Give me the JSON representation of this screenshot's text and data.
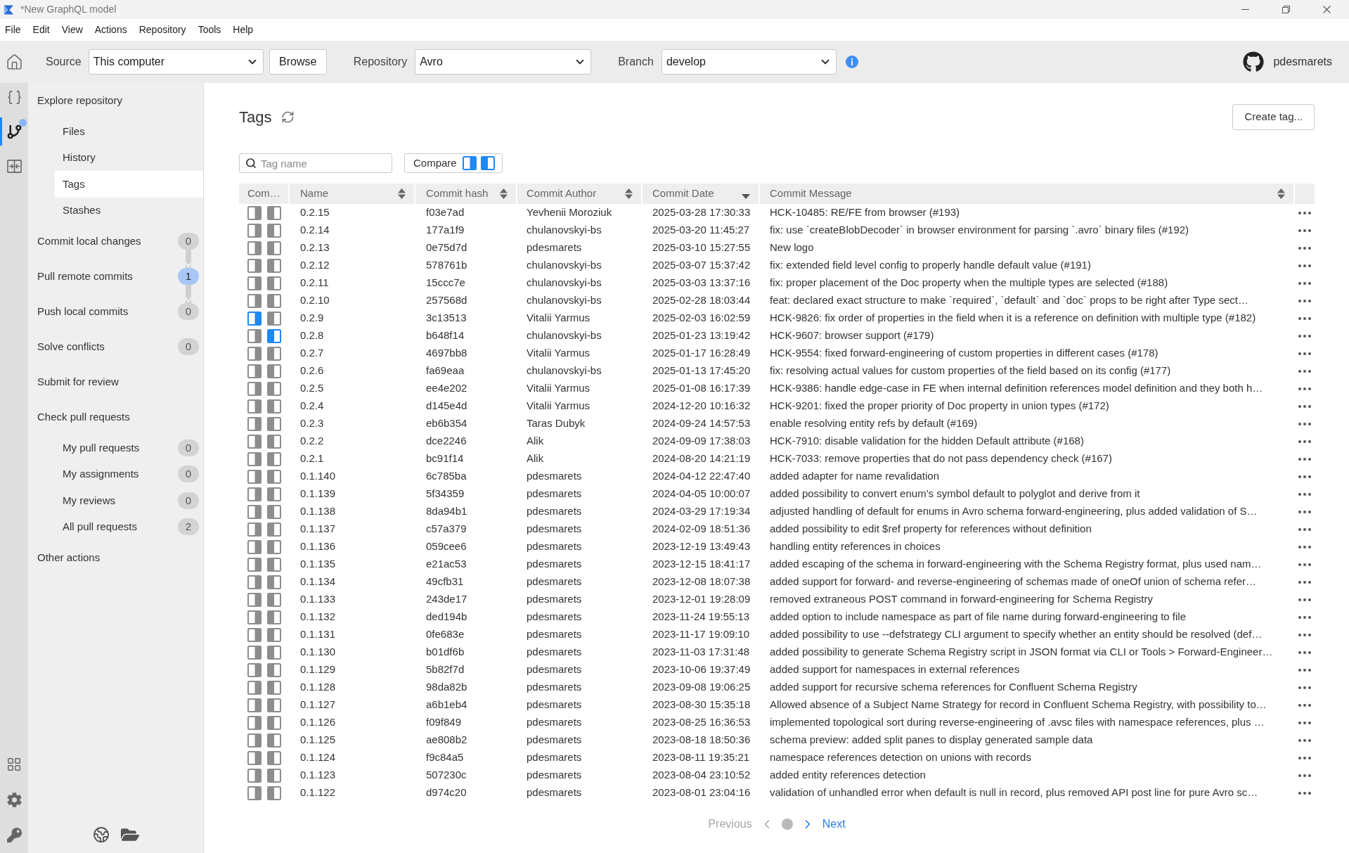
{
  "window": {
    "title": "*New GraphQL model"
  },
  "menu": [
    "File",
    "Edit",
    "View",
    "Actions",
    "Repository",
    "Tools",
    "Help"
  ],
  "toolbar": {
    "source": {
      "label": "Source",
      "value": "This computer"
    },
    "browse_button": "Browse",
    "repository": {
      "label": "Repository",
      "value": "Avro"
    },
    "branch": {
      "label": "Branch",
      "value": "develop"
    },
    "user": "pdesmarets"
  },
  "rail": {
    "items": [
      {
        "selected": false,
        "notification": false
      },
      {
        "selected": true,
        "notification": true
      },
      {
        "selected": false,
        "notification": false
      }
    ]
  },
  "sidebar": {
    "items": [
      {
        "label": "Explore repository",
        "selected": false,
        "children": [
          {
            "label": "Files",
            "selected": false
          },
          {
            "label": "History",
            "selected": false
          },
          {
            "label": "Tags",
            "selected": true
          },
          {
            "label": "Stashes",
            "selected": false
          }
        ]
      },
      {
        "label": "Commit local changes",
        "selected": false,
        "count": "0",
        "highlighted": false,
        "chained": true
      },
      {
        "label": "Pull remote commits",
        "selected": false,
        "count": "1",
        "highlighted": true,
        "chained": true
      },
      {
        "label": "Push local commits",
        "selected": false,
        "count": "0",
        "highlighted": false,
        "chained": true
      },
      {
        "label": "Solve conflicts",
        "selected": false,
        "count": "0",
        "highlighted": false
      },
      {
        "label": "Submit for review",
        "selected": false
      },
      {
        "label": "Check pull requests",
        "selected": false,
        "children": [
          {
            "label": "My pull requests",
            "selected": false,
            "count": "0",
            "highlighted": false
          },
          {
            "label": "My assignments",
            "selected": false,
            "count": "0",
            "highlighted": false
          },
          {
            "label": "My reviews",
            "selected": false,
            "count": "0",
            "highlighted": false
          },
          {
            "label": "All pull requests",
            "selected": false,
            "count": "2",
            "highlighted": false
          }
        ]
      },
      {
        "label": "Other actions",
        "selected": false
      }
    ]
  },
  "tags_page": {
    "title": "Tags",
    "create_button": "Create tag...",
    "search": {
      "placeholder": "Tag name"
    },
    "compare_button": {
      "label": "Compare",
      "disabled": false
    }
  },
  "table": {
    "columns": [
      {
        "label": "Com…",
        "sortable": false,
        "sorted_descending": false
      },
      {
        "label": "Name",
        "sortable": true,
        "sorted_descending": false
      },
      {
        "label": "Commit hash",
        "sortable": true,
        "sorted_descending": false
      },
      {
        "label": "Commit Author",
        "sortable": true,
        "sorted_descending": false
      },
      {
        "label": "Commit Date",
        "sortable": true,
        "sorted_descending": true
      },
      {
        "label": "Commit Message",
        "sortable": true,
        "sorted_descending": false
      }
    ],
    "rows": [
      {
        "compare_left": false,
        "compare_right": false,
        "name": "0.2.15",
        "hash": "f03e7ad",
        "author": "Yevhenii Moroziuk",
        "date": "2025-03-28 17:30:33",
        "message": "HCK-10485: RE/FE from browser (#193)"
      },
      {
        "compare_left": false,
        "compare_right": false,
        "name": "0.2.14",
        "hash": "177a1f9",
        "author": "chulanovskyi-bs",
        "date": "2025-03-20 11:45:27",
        "message": "fix: use `createBlobDecoder` in browser environment for parsing `.avro` binary files (#192)"
      },
      {
        "compare_left": false,
        "compare_right": false,
        "name": "0.2.13",
        "hash": "0e75d7d",
        "author": "pdesmarets",
        "date": "2025-03-10 15:27:55",
        "message": "New logo"
      },
      {
        "compare_left": false,
        "compare_right": false,
        "name": "0.2.12",
        "hash": "578761b",
        "author": "chulanovskyi-bs",
        "date": "2025-03-07 15:37:42",
        "message": "fix: extended field level config to properly handle default value (#191)"
      },
      {
        "compare_left": false,
        "compare_right": false,
        "name": "0.2.11",
        "hash": "15ccc7e",
        "author": "chulanovskyi-bs",
        "date": "2025-03-03 13:37:16",
        "message": "fix: proper placement of the Doc property when the multiple types are selected (#188)"
      },
      {
        "compare_left": false,
        "compare_right": false,
        "name": "0.2.10",
        "hash": "257568d",
        "author": "chulanovskyi-bs",
        "date": "2025-02-28 18:03:44",
        "message": "feat: declared exact structure to make `required`, `default` and `doc` props to be right after Type sect…"
      },
      {
        "compare_left": true,
        "compare_right": false,
        "name": "0.2.9",
        "hash": "3c13513",
        "author": "Vitalii Yarmus",
        "date": "2025-02-03 16:02:59",
        "message": "HCK-9826: fix order of properties in the field when it is a reference on definition with multiple type (#182)"
      },
      {
        "compare_left": false,
        "compare_right": true,
        "name": "0.2.8",
        "hash": "b648f14",
        "author": "chulanovskyi-bs",
        "date": "2025-01-23 13:19:42",
        "message": "HCK-9607: browser support (#179)"
      },
      {
        "compare_left": false,
        "compare_right": false,
        "name": "0.2.7",
        "hash": "4697bb8",
        "author": "Vitalii Yarmus",
        "date": "2025-01-17 16:28:49",
        "message": "HCK-9554: fixed forward-engineering of custom properties in different cases (#178)"
      },
      {
        "compare_left": false,
        "compare_right": false,
        "name": "0.2.6",
        "hash": "fa69eaa",
        "author": "chulanovskyi-bs",
        "date": "2025-01-13 17:45:20",
        "message": "fix: resolving actual values for custom properties of the field based on its config (#177)"
      },
      {
        "compare_left": false,
        "compare_right": false,
        "name": "0.2.5",
        "hash": "ee4e202",
        "author": "Vitalii Yarmus",
        "date": "2025-01-08 16:17:39",
        "message": "HCK-9386: handle edge-case in FE when internal definition references model definition and they both h…"
      },
      {
        "compare_left": false,
        "compare_right": false,
        "name": "0.2.4",
        "hash": "d145e4d",
        "author": "Vitalii Yarmus",
        "date": "2024-12-20 10:16:32",
        "message": "HCK-9201: fixed the proper priority of Doc property in union types (#172)"
      },
      {
        "compare_left": false,
        "compare_right": false,
        "name": "0.2.3",
        "hash": "eb6b354",
        "author": "Taras Dubyk",
        "date": "2024-09-24 14:57:53",
        "message": "enable resolving entity refs by default (#169)"
      },
      {
        "compare_left": false,
        "compare_right": false,
        "name": "0.2.2",
        "hash": "dce2246",
        "author": "Alik",
        "date": "2024-09-09 17:38:03",
        "message": "HCK-7910: disable validation for the hidden Default attribute (#168)"
      },
      {
        "compare_left": false,
        "compare_right": false,
        "name": "0.2.1",
        "hash": "bc91f14",
        "author": "Alik",
        "date": "2024-08-20 14:21:19",
        "message": "HCK-7033: remove properties that do not pass dependency check (#167)"
      },
      {
        "compare_left": false,
        "compare_right": false,
        "name": "0.1.140",
        "hash": "6c785ba",
        "author": "pdesmarets",
        "date": "2024-04-12 22:47:40",
        "message": "added adapter for name revalidation"
      },
      {
        "compare_left": false,
        "compare_right": false,
        "name": "0.1.139",
        "hash": "5f34359",
        "author": "pdesmarets",
        "date": "2024-04-05 10:00:07",
        "message": "added possibility to convert enum's symbol default to polyglot and derive from it"
      },
      {
        "compare_left": false,
        "compare_right": false,
        "name": "0.1.138",
        "hash": "8da94b1",
        "author": "pdesmarets",
        "date": "2024-03-29 17:19:34",
        "message": "adjusted handling of default for enums in Avro schema forward-engineering, plus added validation of S…"
      },
      {
        "compare_left": false,
        "compare_right": false,
        "name": "0.1.137",
        "hash": "c57a379",
        "author": "pdesmarets",
        "date": "2024-02-09 18:51:36",
        "message": "added possibility to edit $ref property for references without definition"
      },
      {
        "compare_left": false,
        "compare_right": false,
        "name": "0.1.136",
        "hash": "059cee6",
        "author": "pdesmarets",
        "date": "2023-12-19 13:49:43",
        "message": "handling entity references in choices"
      },
      {
        "compare_left": false,
        "compare_right": false,
        "name": "0.1.135",
        "hash": "e21ac53",
        "author": "pdesmarets",
        "date": "2023-12-15 18:41:17",
        "message": "added escaping of the schema in forward-engineering with the Schema Registry format, plus used nam…"
      },
      {
        "compare_left": false,
        "compare_right": false,
        "name": "0.1.134",
        "hash": "49cfb31",
        "author": "pdesmarets",
        "date": "2023-12-08 18:07:38",
        "message": "added support for forward- and reverse-engineering of schemas made of oneOf union of schema refer…"
      },
      {
        "compare_left": false,
        "compare_right": false,
        "name": "0.1.133",
        "hash": "243de17",
        "author": "pdesmarets",
        "date": "2023-12-01 19:28:09",
        "message": "removed extraneous POST command in forward-engineering for Schema Registry"
      },
      {
        "compare_left": false,
        "compare_right": false,
        "name": "0.1.132",
        "hash": "ded194b",
        "author": "pdesmarets",
        "date": "2023-11-24 19:55:13",
        "message": "added option to include namespace as part of file name during forward-engineering to file"
      },
      {
        "compare_left": false,
        "compare_right": false,
        "name": "0.1.131",
        "hash": "0fe683e",
        "author": "pdesmarets",
        "date": "2023-11-17 19:09:10",
        "message": "added possibility to use --defstrategy CLI argument to specify whether an entity should be resolved (def…"
      },
      {
        "compare_left": false,
        "compare_right": false,
        "name": "0.1.130",
        "hash": "b01df6b",
        "author": "pdesmarets",
        "date": "2023-11-03 17:31:48",
        "message": "added possibility to generate Schema Registry script in JSON format via CLI or Tools > Forward-Engineer…"
      },
      {
        "compare_left": false,
        "compare_right": false,
        "name": "0.1.129",
        "hash": "5b82f7d",
        "author": "pdesmarets",
        "date": "2023-10-06 19:37:49",
        "message": "added support for namespaces in external references"
      },
      {
        "compare_left": false,
        "compare_right": false,
        "name": "0.1.128",
        "hash": "98da82b",
        "author": "pdesmarets",
        "date": "2023-09-08 19:06:25",
        "message": "added support for recursive schema references for Confluent Schema Registry"
      },
      {
        "compare_left": false,
        "compare_right": false,
        "name": "0.1.127",
        "hash": "a6b1eb4",
        "author": "pdesmarets",
        "date": "2023-08-30 15:35:18",
        "message": "Allowed absence of a Subject Name Strategy for record in Confluent Schema Registry, with possibility to…"
      },
      {
        "compare_left": false,
        "compare_right": false,
        "name": "0.1.126",
        "hash": "f09f849",
        "author": "pdesmarets",
        "date": "2023-08-25 16:36:53",
        "message": "implemented topological sort during reverse-engineering of .avsc files with namespace references, plus …"
      },
      {
        "compare_left": false,
        "compare_right": false,
        "name": "0.1.125",
        "hash": "ae808b2",
        "author": "pdesmarets",
        "date": "2023-08-18 18:50:36",
        "message": "schema preview: added split panes to display generated sample data"
      },
      {
        "compare_left": false,
        "compare_right": false,
        "name": "0.1.124",
        "hash": "f9c84a5",
        "author": "pdesmarets",
        "date": "2023-08-11 19:35:21",
        "message": "namespace references detection on unions with records"
      },
      {
        "compare_left": false,
        "compare_right": false,
        "name": "0.1.123",
        "hash": "507230c",
        "author": "pdesmarets",
        "date": "2023-08-04 23:10:52",
        "message": "added entity references detection"
      },
      {
        "compare_left": false,
        "compare_right": false,
        "name": "0.1.122",
        "hash": "d974c20",
        "author": "pdesmarets",
        "date": "2023-08-01 23:04:16",
        "message": "validation of unhandled error when default is null in record, plus removed API post line for pure Avro sc…"
      }
    ]
  },
  "pagination": {
    "previous": {
      "label": "Previous",
      "disabled": true
    },
    "next": {
      "label": "Next",
      "disabled": false
    }
  }
}
